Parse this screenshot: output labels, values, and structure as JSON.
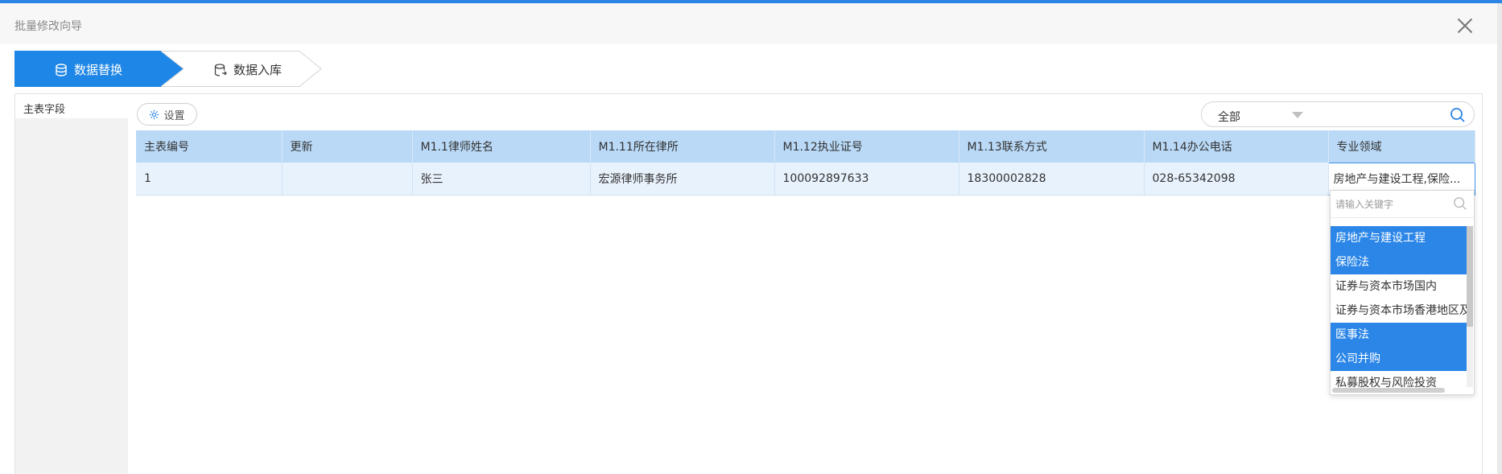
{
  "dialog": {
    "title": "批量修改向导"
  },
  "steps": [
    {
      "label": "数据替换",
      "icon": "database-icon",
      "active": true
    },
    {
      "label": "数据入库",
      "icon": "database-import-icon",
      "active": false
    }
  ],
  "sidebar": {
    "tab_label": "主表字段"
  },
  "toolbar": {
    "settings_label": "设置",
    "filter_value": "全部"
  },
  "table": {
    "columns": [
      "主表编号",
      "更新",
      "M1.1律师姓名",
      "M1.11所在律所",
      "M1.12执业证号",
      "M1.13联系方式",
      "M1.14办公电话",
      "专业领域"
    ],
    "rows": [
      [
        "1",
        "",
        "张三",
        "宏源律师事务所",
        "100092897633",
        "18300002828",
        "028-65342098",
        "房地产与建设工程,保险..."
      ]
    ]
  },
  "dropdown": {
    "search_placeholder": "请输入关键字",
    "options": [
      {
        "label": "房地产与建设工程",
        "selected": true
      },
      {
        "label": "保险法",
        "selected": true
      },
      {
        "label": "证券与资本市场国内",
        "selected": false
      },
      {
        "label": "证券与资本市场香港地区及",
        "selected": false
      },
      {
        "label": "医事法",
        "selected": true
      },
      {
        "label": "公司并购",
        "selected": true
      },
      {
        "label": "私募股权与风险投资",
        "selected": false
      }
    ]
  },
  "colors": {
    "accent": "#1e86e6",
    "header_row": "#b9d9f7",
    "data_row": "#e8f2fc",
    "option_selected": "#2b86e8"
  }
}
